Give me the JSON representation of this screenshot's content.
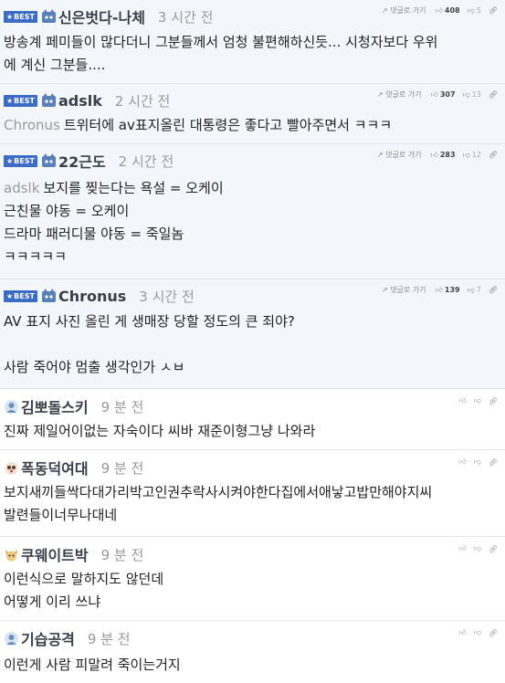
{
  "comments": [
    {
      "best": true,
      "badge": "BEST",
      "nick": "신은벗다-나체",
      "time": "3 시간 전",
      "reply": "댓글로 가기",
      "up": "408",
      "down": "5",
      "lines": [
        "방송계 페미들이 많다더니 그분들께서 엄청 불편해하신듯... 시청자보다 우위",
        "에 계신 그분들...."
      ]
    },
    {
      "best": true,
      "badge": "BEST",
      "nick": "adslk",
      "time": "2 시간 전",
      "reply": "댓글로 가기",
      "up": "307",
      "down": "13",
      "mention": "Chronus",
      "lines": [
        "트위터에 av표지올린 대통령은 좋다고 빨아주면서 ㅋㅋㅋ"
      ]
    },
    {
      "best": true,
      "badge": "BEST",
      "nick": "22근도",
      "time": "2 시간 전",
      "reply": "댓글로 가기",
      "up": "283",
      "down": "12",
      "mention": "adslk",
      "lines": [
        "보지를 찢는다는 욕설 = 오케이",
        "근친물 야동 = 오케이",
        "드라마 패러디물 야동 = 죽일놈",
        "ㅋㅋㅋㅋㅋ"
      ]
    },
    {
      "best": true,
      "badge": "BEST",
      "nick": "Chronus",
      "time": "3 시간 전",
      "reply": "댓글로 가기",
      "up": "139",
      "down": "7",
      "lines": [
        "AV 표지 사진 올린 게 생매장 당할 정도의 큰 죄야?",
        "",
        "사람 죽어야 멈출 생각인가 ㅅㅂ"
      ]
    },
    {
      "best": false,
      "nick": "김뽀돌스키",
      "time": "9 분 전",
      "lines": [
        "진짜 제일어이없는 자숙이다 씨바 재준이형그냥 나와라"
      ]
    },
    {
      "best": false,
      "nick": "폭동덕여대",
      "time": "9 분 전",
      "lines": [
        "보지새끼들싹다대가리박고인권추락사시켜야한다집에서애낳고밥만해야지씨",
        "발련들이너무나대네"
      ]
    },
    {
      "best": false,
      "nick": "쿠웨이트박",
      "time": "9 분 전",
      "lines": [
        "이런식으로 말하지도 않던데",
        "어떻게 이리 쓰냐"
      ]
    },
    {
      "best": false,
      "nick": "기습공격",
      "time": "9 분 전",
      "lines": [
        "이런게 사람 피말려 죽이는거지"
      ]
    }
  ],
  "icons": {
    "reply": "reply-arrow-icon",
    "up": "thumbs-up-icon",
    "down": "thumbs-down-icon",
    "link": "link-icon",
    "avatar_best": "cat-avatar-icon",
    "avatar_normal": "user-avatar-icon"
  },
  "colors": {
    "best_bg": "#f3f6fb",
    "badge": "#3d6cc4",
    "nick": "#3a3f4a",
    "time": "#9a9a9a"
  }
}
